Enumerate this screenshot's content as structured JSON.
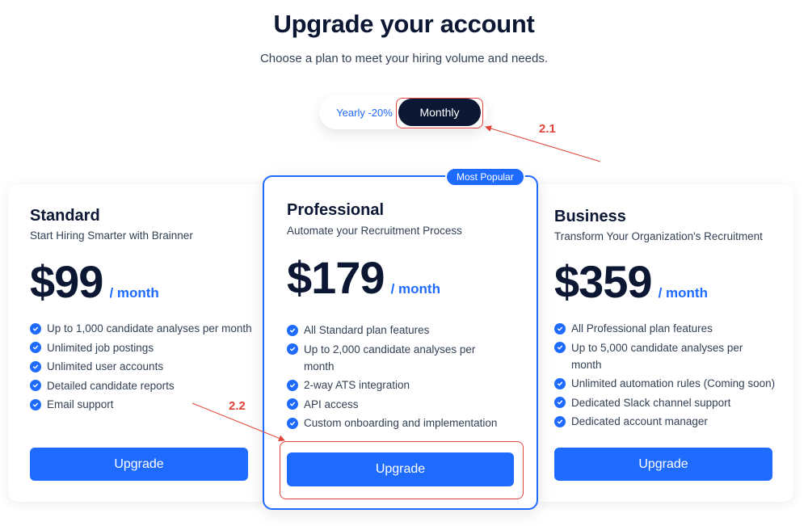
{
  "header": {
    "title": "Upgrade your account",
    "subtitle": "Choose a plan to meet your hiring volume and needs."
  },
  "billing_toggle": {
    "yearly_label": "Yearly -20%",
    "monthly_label": "Monthly",
    "selected": "Monthly"
  },
  "annotations": {
    "label_1": "2.1",
    "label_2": "2.2",
    "color": "#e0443a"
  },
  "plans": [
    {
      "name": "Standard",
      "tagline": "Start Hiring Smarter with Brainner",
      "price": "$99",
      "period": "/ month",
      "features": [
        "Up to 1,000 candidate analyses per month",
        "Unlimited job postings",
        "Unlimited user accounts",
        "Detailed candidate reports",
        "Email support"
      ],
      "button_label": "Upgrade"
    },
    {
      "name": "Professional",
      "tagline": "Automate your Recruitment Process",
      "badge": "Most Popular",
      "price": "$179",
      "period": "/ month",
      "features": [
        "All Standard plan features",
        "Up to 2,000 candidate analyses per month",
        "2-way ATS integration",
        "API access",
        "Custom onboarding and implementation"
      ],
      "button_label": "Upgrade"
    },
    {
      "name": "Business",
      "tagline": "Transform Your Organization's Recruitment",
      "price": "$359",
      "period": "/ month",
      "features": [
        "All Professional plan features",
        "Up to 5,000 candidate analyses per month",
        "Unlimited automation rules (Coming soon)",
        "Dedicated Slack channel support",
        "Dedicated account manager"
      ],
      "button_label": "Upgrade"
    }
  ],
  "colors": {
    "accent": "#1f6bff",
    "heading": "#0b1733",
    "body_text": "#334155"
  },
  "icons": {
    "feature": "check-circle-icon"
  }
}
